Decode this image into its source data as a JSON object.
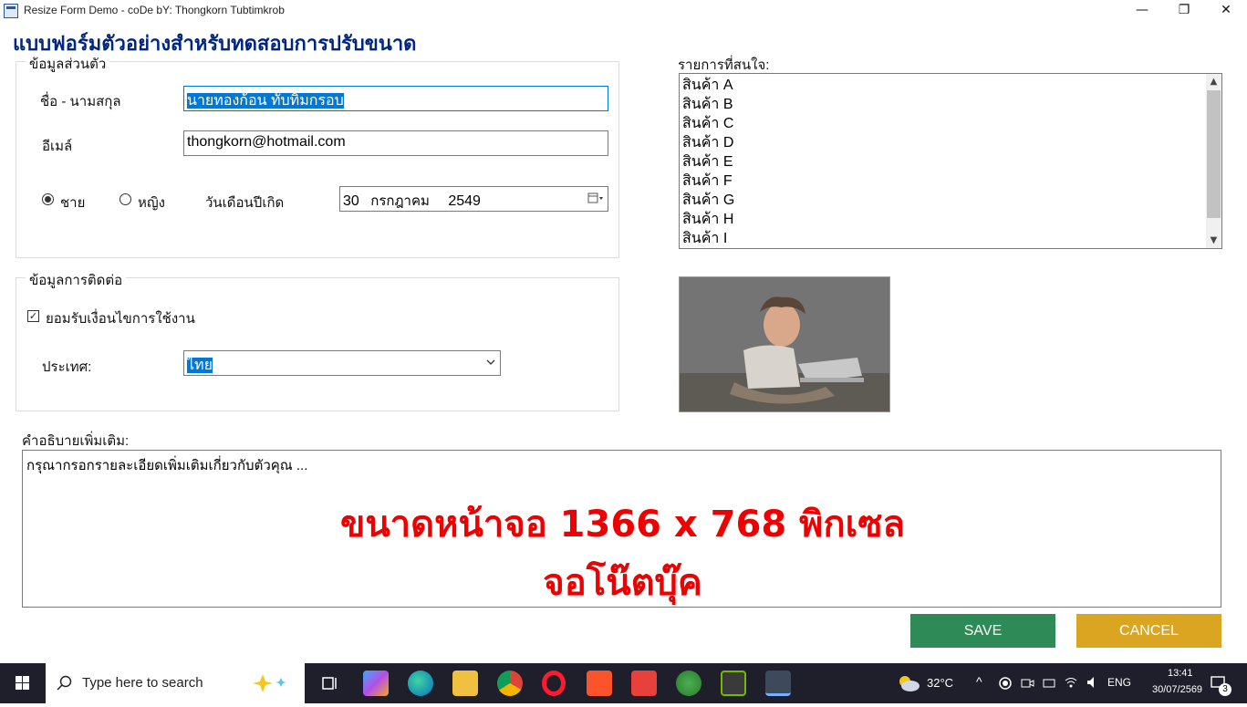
{
  "window": {
    "title": "Resize Form Demo - coDe bY: Thongkorn Tubtimkrob",
    "minimize_glyph": "—",
    "restore_glyph": "❐",
    "close_glyph": "✕"
  },
  "header": {
    "title": "แบบฟอร์มตัวอย่างสำหรับทดสอบการปรับขนาด"
  },
  "personal": {
    "group_title": "ข้อมูลส่วนตัว",
    "name_label": "ชื่อ - นามสกุล",
    "name_value": "นายทองก้อน ทับทิมกรอบ",
    "email_label": "อีเมล์",
    "email_value": "thongkorn@hotmail.com",
    "male_label": "ชาย",
    "female_label": "หญิง",
    "birthdate_label": "วันเดือนปีเกิด",
    "birth_day": "30",
    "birth_month": "กรกฎาคม",
    "birth_year": "2549"
  },
  "interests": {
    "label": "รายการที่สนใจ:",
    "items": [
      "สินค้า A",
      "สินค้า B",
      "สินค้า C",
      "สินค้า D",
      "สินค้า E",
      "สินค้า F",
      "สินค้า G",
      "สินค้า H",
      "สินค้า I"
    ]
  },
  "contact": {
    "group_title": "ข้อมูลการติดต่อ",
    "accept_label": "ยอมรับเงื่อนไขการใช้งาน",
    "accept_checked": true,
    "country_label": "ประเทศ:",
    "country_value": "ไทย"
  },
  "description": {
    "label": "คำอธิบายเพิ่มเติม:",
    "value": "กรุณากรอกรายละเอียดเพิ่มเติมเกี่ยวกับตัวคุณ ...",
    "overlay_line1": "ขนาดหน้าจอ 1366 x 768 พิกเซล",
    "overlay_line2": "จอโน๊ตบุ๊ค"
  },
  "buttons": {
    "save_label": "SAVE",
    "save_color": "#2e8b57",
    "cancel_label": "CANCEL",
    "cancel_color": "#daa520"
  },
  "taskbar": {
    "search_placeholder": "Type here to search",
    "weather": "32°C",
    "language": "ENG",
    "time": "13:41",
    "date": "30/07/2569",
    "notification_count": "3"
  }
}
